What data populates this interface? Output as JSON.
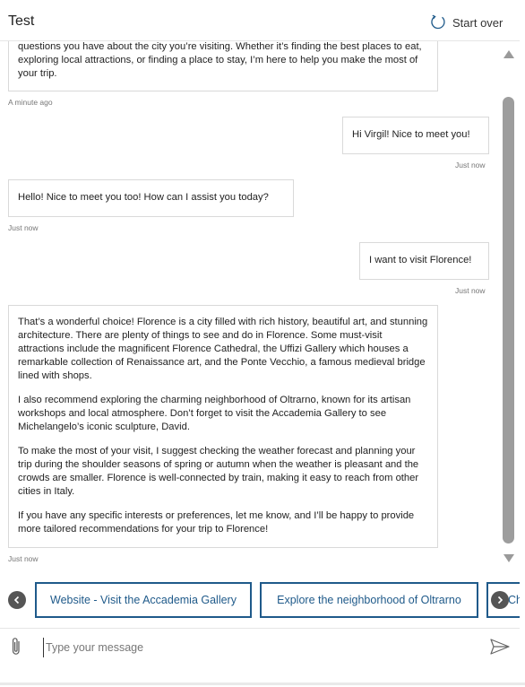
{
  "header": {
    "title": "Test",
    "restart_label": "Start over",
    "restart_icon": "refresh-icon"
  },
  "messages": [
    {
      "from": "bot",
      "paragraphs": [
        "questions you have about the city you’re visiting. Whether it’s finding the best places to eat, exploring local attractions, or finding a place to stay, I’m here to help you make the most of your trip."
      ],
      "timestamp": "A minute ago"
    },
    {
      "from": "user",
      "paragraphs": [
        "Hi Virgil! Nice to meet you!"
      ],
      "timestamp": "Just now"
    },
    {
      "from": "bot",
      "paragraphs": [
        "Hello! Nice to meet you too! How can I assist you today?"
      ],
      "timestamp": "Just now"
    },
    {
      "from": "user",
      "paragraphs": [
        "I want to visit Florence!"
      ],
      "timestamp": "Just now"
    },
    {
      "from": "bot",
      "paragraphs": [
        "That’s a wonderful choice! Florence is a city filled with rich history, beautiful art, and stunning architecture. There are plenty of things to see and do in Florence. Some must-visit attractions include the magnificent Florence Cathedral, the Uffizi Gallery which houses a remarkable collection of Renaissance art, and the Ponte Vecchio, a famous medieval bridge lined with shops.",
        "I also recommend exploring the charming neighborhood of Oltrarno, known for its artisan workshops and local atmosphere. Don’t forget to visit the Accademia Gallery to see Michelangelo’s iconic sculpture, David.",
        "To make the most of your visit, I suggest checking the weather forecast and planning your trip during the shoulder seasons of spring or autumn when the weather is pleasant and the crowds are smaller. Florence is well-connected by train, making it easy to reach from other cities in Italy.",
        "If you have any specific interests or preferences, let me know, and I’ll be happy to provide more tailored recommendations for your trip to Florence!"
      ],
      "timestamp": "Just now"
    }
  ],
  "suggested_actions": {
    "items": [
      "Website - Visit the Accademia Gallery",
      "Explore the neighborhood of Oltrarno",
      "Ch"
    ],
    "prev_icon": "chevron-left-icon",
    "next_icon": "chevron-right-icon"
  },
  "composer": {
    "placeholder": "Type your message",
    "value": "",
    "attach_icon": "paperclip-icon",
    "send_icon": "send-icon"
  },
  "colors": {
    "accent": "#1f5a8a",
    "border": "#d9d9d9",
    "scroll_thumb": "#9d9d9d"
  }
}
